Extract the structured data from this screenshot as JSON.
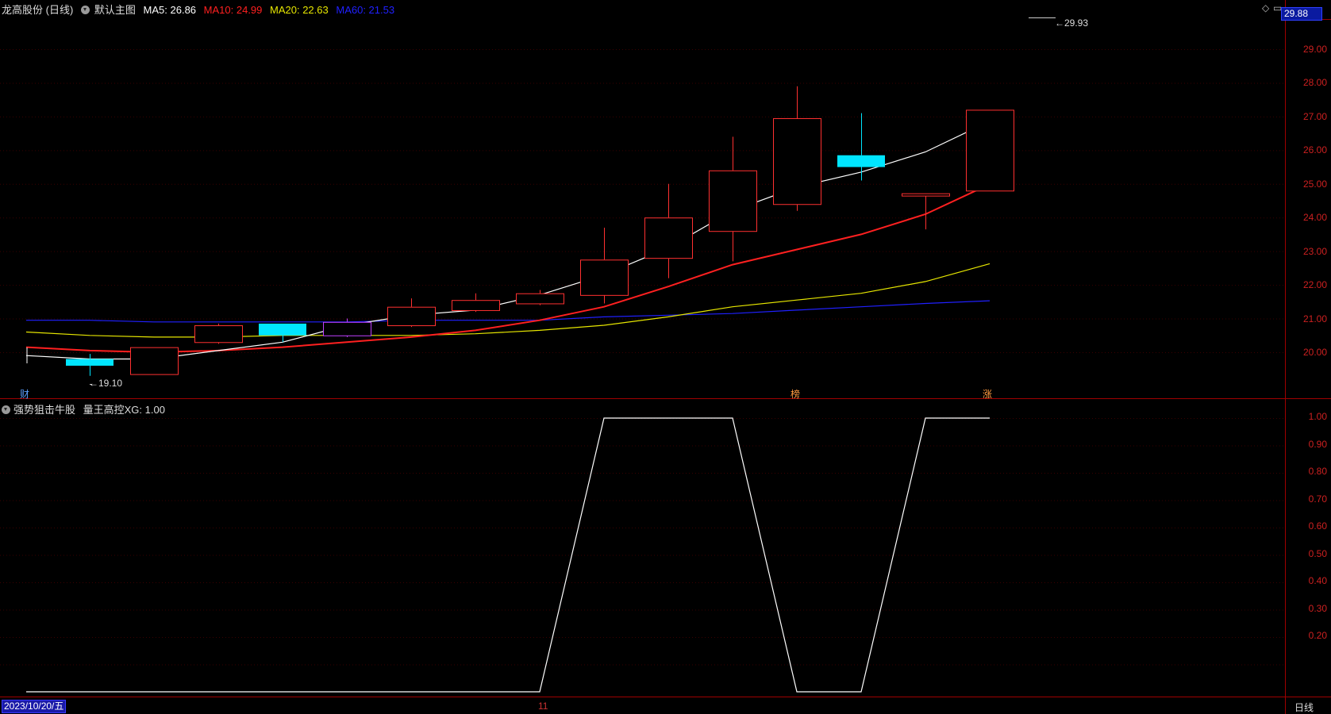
{
  "header": {
    "stock": "龙高股份 (日线)",
    "template": "默认主图",
    "ma5": "MA5: 26.86",
    "ma10": "MA10: 24.99",
    "ma20": "MA20: 22.63",
    "ma60": "MA60: 21.53",
    "colors": {
      "ma5": "#ffffff",
      "ma10": "#ff2020",
      "ma20": "#e6e600",
      "ma60": "#2020ff"
    }
  },
  "indicator": {
    "name": "强势狙击牛股",
    "value": "量王高控XG: 1.00"
  },
  "price_panel": {
    "current_price_tag": "29.88",
    "high_label": "29.93",
    "low_label": "19.10",
    "y_axis_labels": [
      "29.00",
      "28.00",
      "27.00",
      "26.00",
      "25.00",
      "24.00",
      "23.00",
      "22.00",
      "21.00",
      "20.00"
    ]
  },
  "indicator_panel": {
    "y_axis_labels": [
      "1.00",
      "0.90",
      "0.80",
      "0.70",
      "0.60",
      "0.50",
      "0.40",
      "0.30",
      "0.20"
    ]
  },
  "markers": {
    "cai": "财",
    "bang": "榜",
    "zhang": "涨"
  },
  "footer": {
    "date": "2023/10/20/五",
    "month_tick": "11",
    "period": "日线"
  },
  "chart_data": {
    "type": "candlestick",
    "candles": [
      {
        "o": 19.6,
        "c": 19.8,
        "h": 19.95,
        "l": 19.3,
        "up": false
      },
      {
        "o": 19.35,
        "c": 20.15,
        "h": 20.15,
        "l": 19.35,
        "up": true
      },
      {
        "o": 20.3,
        "c": 20.8,
        "h": 20.85,
        "l": 20.25,
        "up": true
      },
      {
        "o": 20.85,
        "c": 20.5,
        "h": 20.85,
        "l": 20.3,
        "up": false
      },
      {
        "o": 20.5,
        "c": 20.9,
        "h": 21.0,
        "l": 20.45,
        "up": true,
        "purple": true
      },
      {
        "o": 20.8,
        "c": 21.35,
        "h": 21.6,
        "l": 20.75,
        "up": true
      },
      {
        "o": 21.25,
        "c": 21.55,
        "h": 21.75,
        "l": 21.2,
        "up": true
      },
      {
        "o": 21.45,
        "c": 21.75,
        "h": 21.85,
        "l": 21.4,
        "up": true
      },
      {
        "o": 21.7,
        "c": 22.75,
        "h": 23.7,
        "l": 21.45,
        "up": true
      },
      {
        "o": 22.8,
        "c": 24.0,
        "h": 25.0,
        "l": 22.2,
        "up": true
      },
      {
        "o": 23.6,
        "c": 25.4,
        "h": 26.4,
        "l": 22.7,
        "up": true
      },
      {
        "o": 24.4,
        "c": 26.95,
        "h": 27.9,
        "l": 24.2,
        "up": true
      },
      {
        "o": 25.85,
        "c": 25.5,
        "h": 27.1,
        "l": 25.1,
        "up": false
      },
      {
        "o": 24.65,
        "c": 24.72,
        "h": 24.72,
        "l": 23.65,
        "up": true
      },
      {
        "o": 24.8,
        "c": 27.2,
        "h": 27.2,
        "l": 24.8,
        "up": true
      }
    ],
    "ma5": [
      19.9,
      19.8,
      19.8,
      20.05,
      20.3,
      20.8,
      21.1,
      21.25,
      21.7,
      22.3,
      23.1,
      24.2,
      24.9,
      25.35,
      25.95,
      26.86
    ],
    "ma10": [
      20.15,
      20.05,
      20.0,
      20.05,
      20.15,
      20.3,
      20.45,
      20.65,
      20.95,
      21.35,
      21.95,
      22.6,
      23.05,
      23.5,
      24.1,
      24.99
    ],
    "ma20": [
      20.6,
      20.5,
      20.45,
      20.45,
      20.5,
      20.5,
      20.5,
      20.55,
      20.65,
      20.8,
      21.05,
      21.35,
      21.55,
      21.75,
      22.1,
      22.63
    ],
    "ma60": [
      20.95,
      20.95,
      20.9,
      20.9,
      20.9,
      20.9,
      20.95,
      20.95,
      20.95,
      21.05,
      21.1,
      21.15,
      21.25,
      21.35,
      21.45,
      21.53
    ],
    "xg": [
      0,
      0,
      0,
      0,
      0,
      0,
      0,
      0,
      0,
      1,
      1,
      1,
      0,
      0,
      1,
      1
    ],
    "ylim": [
      19.0,
      30.0
    ],
    "xg_ylim": [
      0,
      1
    ]
  }
}
